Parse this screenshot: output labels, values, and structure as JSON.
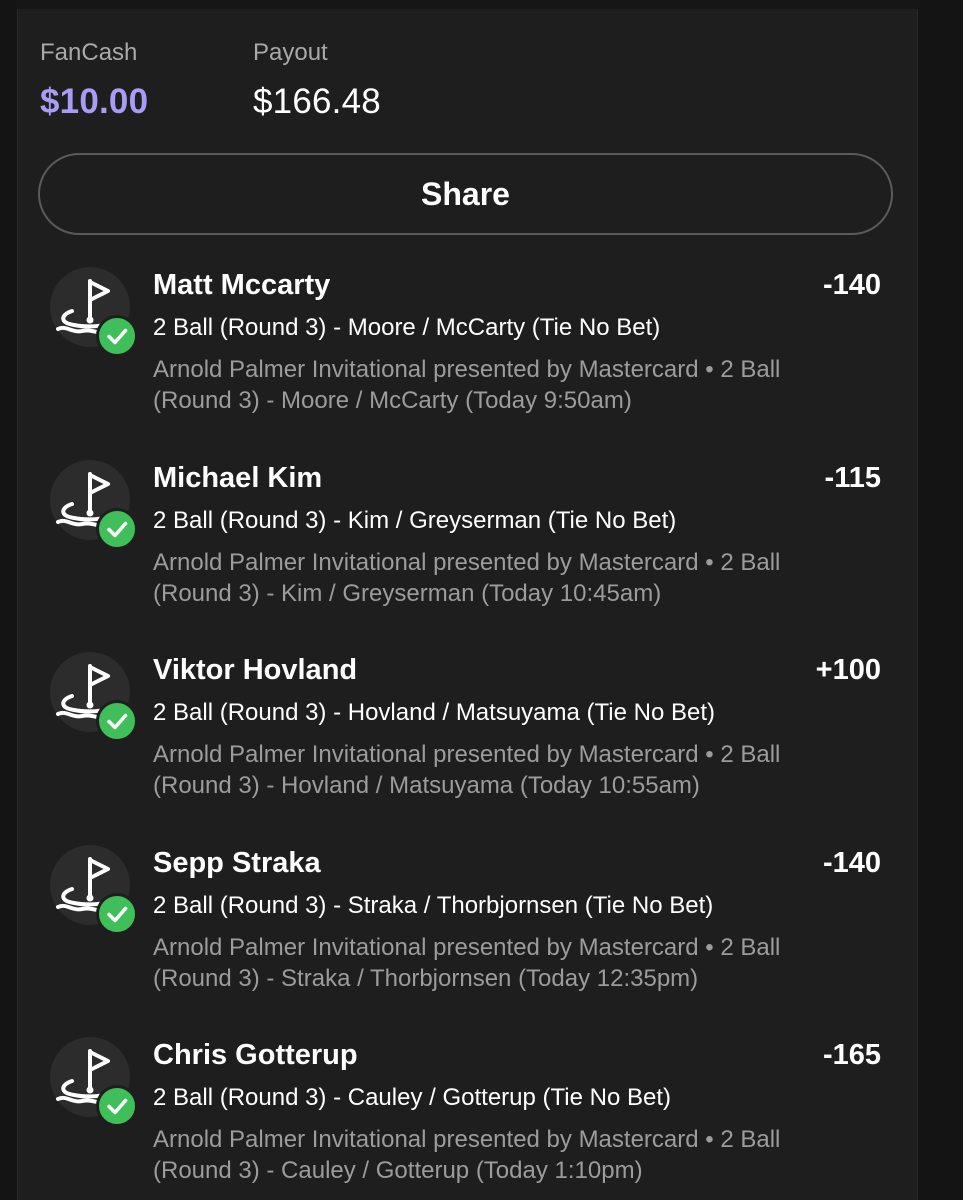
{
  "summary": {
    "fancash_label": "FanCash",
    "fancash_value": "$10.00",
    "payout_label": "Payout",
    "payout_value": "$166.48"
  },
  "share_label": "Share",
  "colors": {
    "fancash_accent": "#a99cf6",
    "check_green": "#3fbf59",
    "background": "#1e1e1e",
    "muted_text": "#9c9c9c"
  },
  "bets": [
    {
      "icon": "golf-flag-icon",
      "status_icon": "check-icon",
      "name": "Matt Mccarty",
      "odds": "-140",
      "market": "2 Ball (Round 3) - Moore / McCarty (Tie No Bet)",
      "event_line1": "Arnold Palmer Invitational presented by Mastercard • 2 Ball",
      "event_line2": "(Round 3) - Moore / McCarty (Today 9:50am)"
    },
    {
      "icon": "golf-flag-icon",
      "status_icon": "check-icon",
      "name": "Michael Kim",
      "odds": "-115",
      "market": "2 Ball (Round 3) - Kim / Greyserman (Tie No Bet)",
      "event_line1": "Arnold Palmer Invitational presented by Mastercard • 2 Ball",
      "event_line2": "(Round 3) - Kim / Greyserman (Today 10:45am)"
    },
    {
      "icon": "golf-flag-icon",
      "status_icon": "check-icon",
      "name": "Viktor Hovland",
      "odds": "+100",
      "market": "2 Ball (Round 3) - Hovland / Matsuyama (Tie No Bet)",
      "event_line1": "Arnold Palmer Invitational presented by Mastercard • 2 Ball",
      "event_line2": "(Round 3) - Hovland / Matsuyama (Today 10:55am)"
    },
    {
      "icon": "golf-flag-icon",
      "status_icon": "check-icon",
      "name": "Sepp Straka",
      "odds": "-140",
      "market": "2 Ball (Round 3) - Straka / Thorbjornsen (Tie No Bet)",
      "event_line1": "Arnold Palmer Invitational presented by Mastercard • 2 Ball",
      "event_line2": "(Round 3) - Straka / Thorbjornsen (Today 12:35pm)"
    },
    {
      "icon": "golf-flag-icon",
      "status_icon": "check-icon",
      "name": "Chris Gotterup",
      "odds": "-165",
      "market": "2 Ball (Round 3) - Cauley / Gotterup (Tie No Bet)",
      "event_line1": "Arnold Palmer Invitational presented by Mastercard • 2 Ball",
      "event_line2": "(Round 3) - Cauley / Gotterup (Today 1:10pm)"
    }
  ]
}
